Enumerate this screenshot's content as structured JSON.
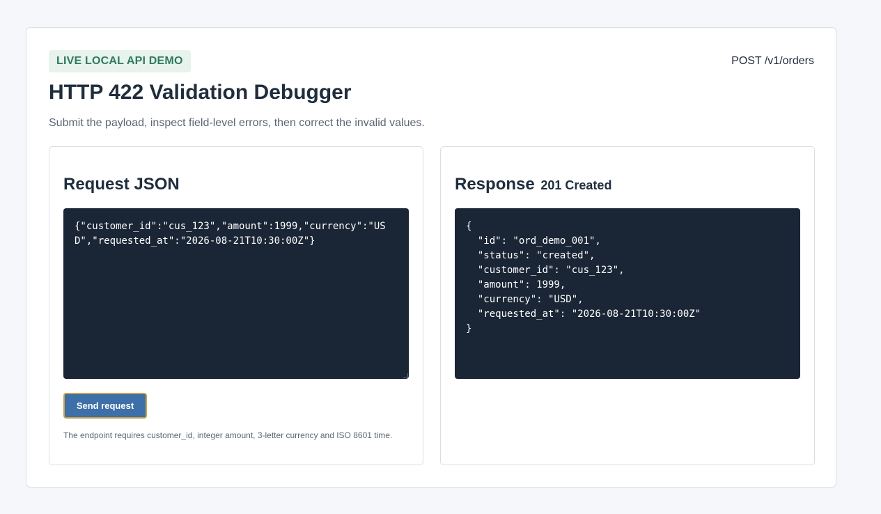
{
  "header": {
    "badge": "LIVE LOCAL API DEMO",
    "endpoint": "POST /v1/orders",
    "title": "HTTP 422 Validation Debugger",
    "subtitle": "Submit the payload, inspect field-level errors, then correct the invalid values."
  },
  "request": {
    "title": "Request JSON",
    "body": "{\"customer_id\":\"cus_123\",\"amount\":1999,\"currency\":\"USD\",\"requested_at\":\"2026-08-21T10:30:00Z\"}",
    "send_label": "Send request",
    "helper": "The endpoint requires customer_id, integer amount, 3-letter currency and ISO 8601 time."
  },
  "response": {
    "title": "Response",
    "status": "201 Created",
    "body": "{\n  \"id\": \"ord_demo_001\",\n  \"status\": \"created\",\n  \"customer_id\": \"cus_123\",\n  \"amount\": 1999,\n  \"currency\": \"USD\",\n  \"requested_at\": \"2026-08-21T10:30:00Z\"\n}"
  },
  "colors": {
    "badge_bg": "#e8f3ee",
    "badge_text": "#2f7b5c",
    "code_bg": "#1a2535",
    "button_bg": "#3d6fa8",
    "button_focus_ring": "#c9a24a"
  }
}
